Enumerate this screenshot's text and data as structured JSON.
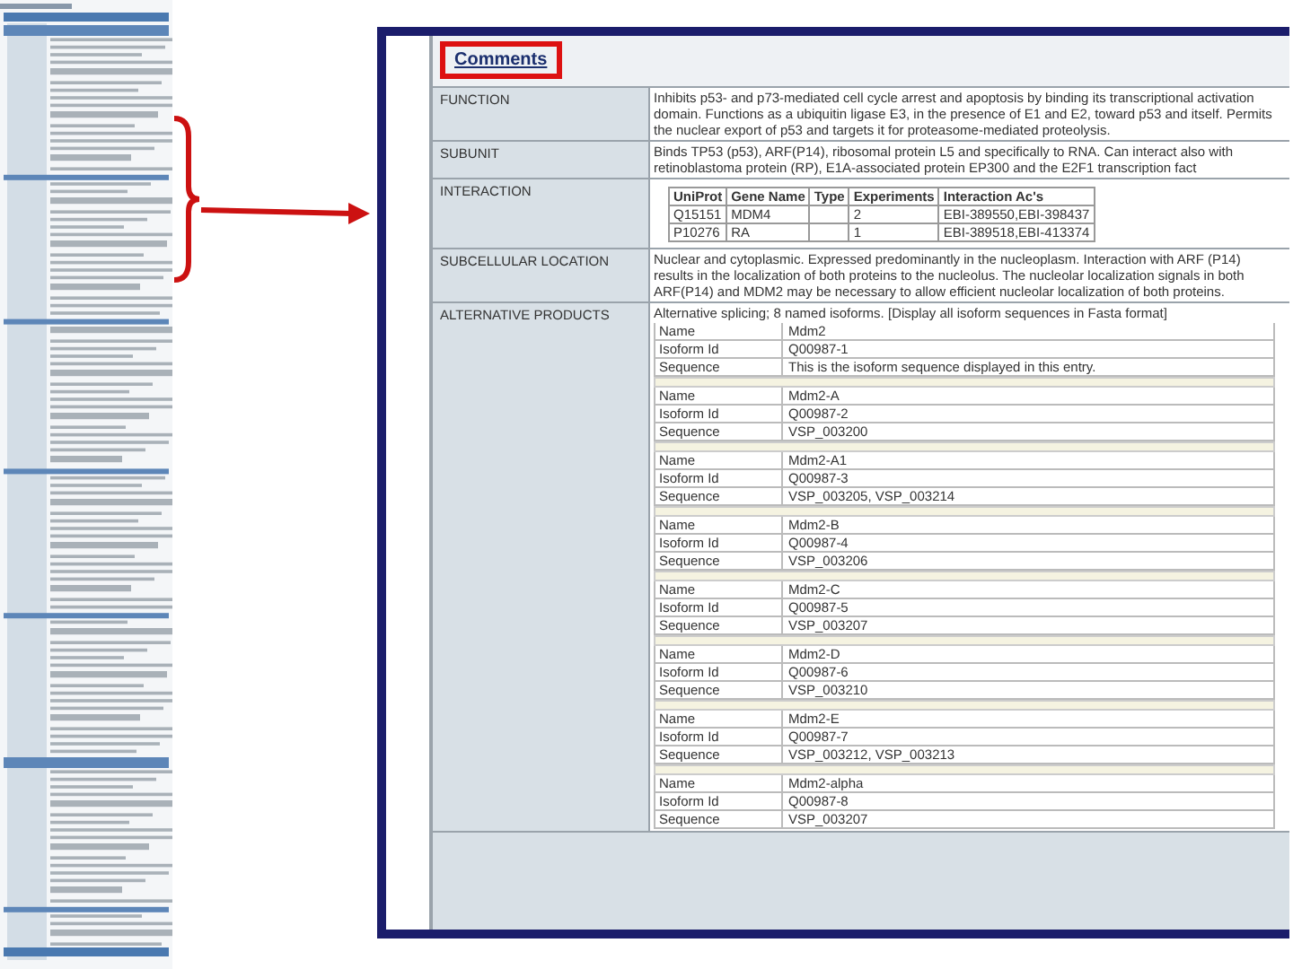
{
  "comments": {
    "title": "Comments",
    "highlighted": true
  },
  "sections": [
    {
      "kind": "text",
      "label": "FUNCTION",
      "text": "Inhibits p53- and p73-mediated cell cycle arrest and apoptosis by binding its transcriptional activation domain. Functions as a ubiquitin ligase E3, in the presence of E1 and E2, toward p53 and itself. Permits the nuclear export of p53 and targets it for proteasome-mediated proteolysis."
    },
    {
      "kind": "text",
      "label": "SUBUNIT",
      "text": "Binds TP53 (p53), ARF(P14), ribosomal protein L5 and specifically to RNA. Can interact also with retinoblastoma protein (RP), E1A-associated protein EP300 and the E2F1 transcription fact"
    },
    {
      "kind": "interaction",
      "label": "INTERACTION",
      "columns": [
        "UniProt",
        "Gene Name",
        "Type",
        "Experiments",
        "Interaction Ac's"
      ],
      "rows": [
        [
          "Q15151",
          "MDM4",
          "",
          "2",
          "EBI-389550,EBI-398437"
        ],
        [
          "P10276",
          "RA",
          "",
          "1",
          "EBI-389518,EBI-413374"
        ]
      ]
    },
    {
      "kind": "text",
      "label": "SUBCELLULAR LOCATION",
      "text": "Nuclear and cytoplasmic. Expressed predominantly in the nucleoplasm. Interaction with ARF (P14) results in the localization of both proteins to the nucleolus. The nucleolar localization signals in both ARF(P14) and MDM2 may be necessary to allow efficient nucleolar localization of both proteins."
    },
    {
      "kind": "isoforms",
      "label": "ALTERNATIVE PRODUCTS",
      "intro": "Alternative splicing; 8 named isoforms.",
      "link": "[Display all isoform sequences in Fasta format]",
      "isoforms": [
        [
          {
            "label": "Name",
            "value": "Mdm2"
          },
          {
            "label": "Isoform Id",
            "value": "Q00987-1"
          },
          {
            "label": "Sequence",
            "value": "This is the isoform sequence displayed in this entry."
          }
        ],
        [
          {
            "label": "Name",
            "value": "Mdm2-A"
          },
          {
            "label": "Isoform Id",
            "value": "Q00987-2"
          },
          {
            "label": "Sequence",
            "value": "VSP_003200"
          }
        ],
        [
          {
            "label": "Name",
            "value": "Mdm2-A1"
          },
          {
            "label": "Isoform Id",
            "value": "Q00987-3"
          },
          {
            "label": "Sequence",
            "value": "VSP_003205, VSP_003214"
          }
        ],
        [
          {
            "label": "Name",
            "value": "Mdm2-B"
          },
          {
            "label": "Isoform Id",
            "value": "Q00987-4"
          },
          {
            "label": "Sequence",
            "value": "VSP_003206"
          }
        ],
        [
          {
            "label": "Name",
            "value": "Mdm2-C"
          },
          {
            "label": "Isoform Id",
            "value": "Q00987-5"
          },
          {
            "label": "Sequence",
            "value": "VSP_003207"
          }
        ],
        [
          {
            "label": "Name",
            "value": "Mdm2-D"
          },
          {
            "label": "Isoform Id",
            "value": "Q00987-6"
          },
          {
            "label": "Sequence",
            "value": "VSP_003210"
          }
        ],
        [
          {
            "label": "Name",
            "value": "Mdm2-E"
          },
          {
            "label": "Isoform Id",
            "value": "Q00987-7"
          },
          {
            "label": "Sequence",
            "value": "VSP_003212, VSP_003213"
          }
        ],
        [
          {
            "label": "Name",
            "value": "Mdm2-alpha"
          },
          {
            "label": "Isoform Id",
            "value": "Q00987-8"
          },
          {
            "label": "Sequence",
            "value": "VSP_003207"
          }
        ]
      ]
    }
  ]
}
